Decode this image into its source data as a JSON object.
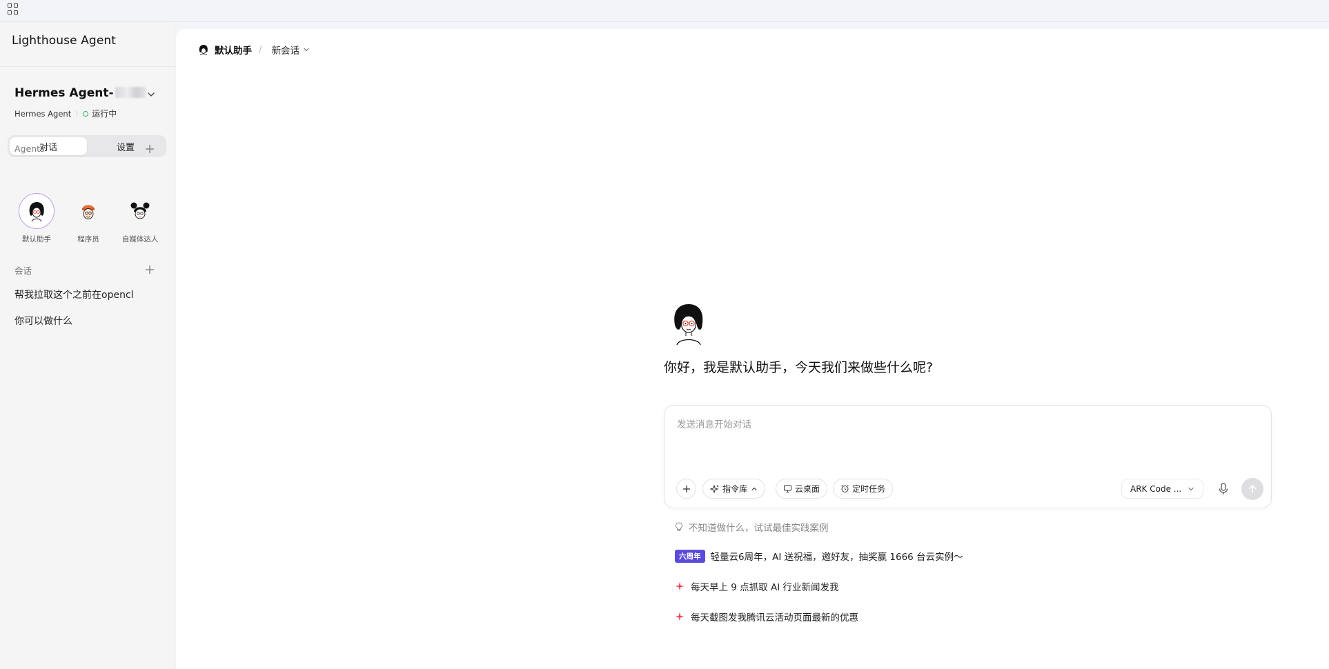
{
  "sidebar": {
    "brand": "Lighthouse Agent",
    "instance": {
      "name": "Hermes Agent-",
      "type": "Hermes Agent",
      "status": "运行中"
    },
    "tabs": [
      {
        "label": "对话",
        "active": true
      },
      {
        "label": "设置",
        "active": false
      }
    ],
    "agents_title": "Agents",
    "agents": [
      {
        "label": "默认助手",
        "icon": "avatar-woman-glasses",
        "active": true
      },
      {
        "label": "程序员",
        "icon": "avatar-programmer-beanie",
        "active": false
      },
      {
        "label": "自媒体达人",
        "icon": "avatar-girl-buns",
        "active": false
      }
    ],
    "conversations_title": "会话",
    "conversations": [
      {
        "title": "帮我拉取这个之前在opencl"
      },
      {
        "title": "你可以做什么"
      }
    ]
  },
  "header": {
    "assistant": "默认助手",
    "separator": "/",
    "session": "新会话"
  },
  "main": {
    "greeting": "你好，我是默认助手，今天我们来做些什么呢?",
    "composer": {
      "placeholder": "发送消息开始对话",
      "value": "",
      "chips": {
        "commands": "指令库",
        "desktop": "云桌面",
        "schedule": "定时任务"
      },
      "model": "ARK Code ..."
    },
    "tip": "不知道做什么，试试最佳实践案例",
    "suggestions": [
      {
        "badge": "六周年",
        "text": "轻量云6周年，AI 送祝福，邀好友，抽奖赢 1666 台云实例～"
      },
      {
        "text": "每天早上 9 点抓取 AI 行业新闻发我",
        "icon": "sparkle-icon"
      },
      {
        "text": "每天截图发我腾讯云活动页面最新的优惠",
        "icon": "sparkle-icon"
      }
    ]
  },
  "colors": {
    "accent": "#5b4bdb",
    "status_running": "#2bb55a",
    "sparkle": "#f04a5a"
  }
}
